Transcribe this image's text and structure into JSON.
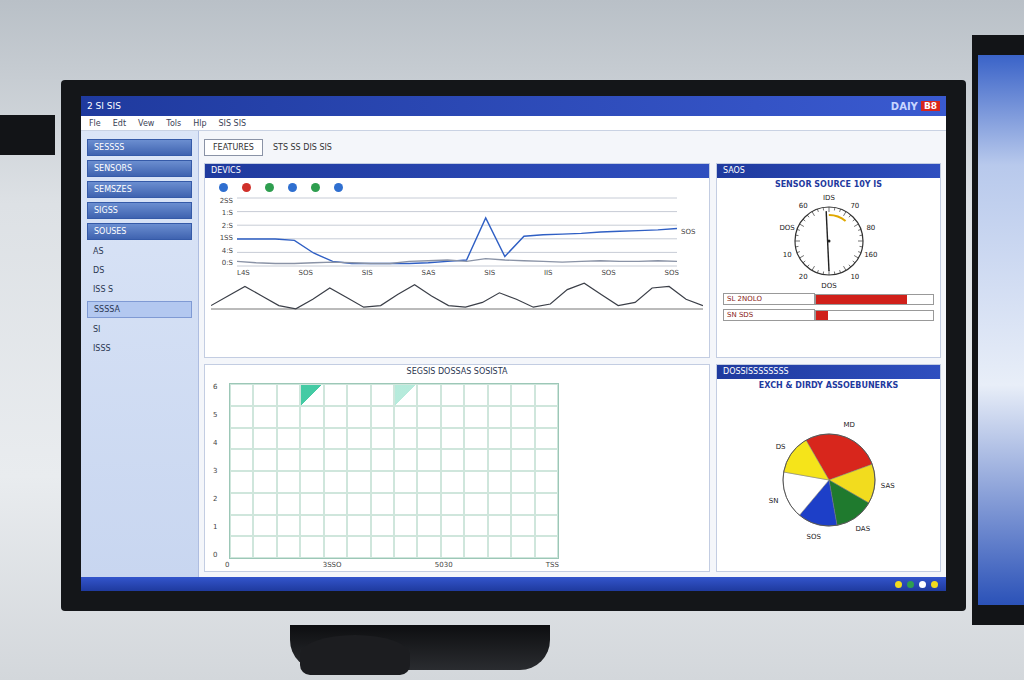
{
  "window": {
    "title": "2 SI SIS",
    "badge": "DAIY",
    "badge_code": "B8"
  },
  "menu": [
    "Fle",
    "Edt",
    "Vew",
    "Tols",
    "Hlp",
    "SIS SIS"
  ],
  "sidebar": {
    "items": [
      {
        "label": "SESSSS",
        "kind": "header",
        "selected": false
      },
      {
        "label": "SENSORS",
        "kind": "header",
        "selected": false
      },
      {
        "label": "SEMSZES",
        "kind": "header",
        "selected": false
      },
      {
        "label": "SIGSS",
        "kind": "header",
        "selected": false
      },
      {
        "label": "SOUSES",
        "kind": "header",
        "selected": false
      },
      {
        "label": "AS",
        "kind": "item",
        "selected": false
      },
      {
        "label": "DS",
        "kind": "item",
        "selected": false
      },
      {
        "label": "ISS S",
        "kind": "item",
        "selected": false
      },
      {
        "label": "SSSSA",
        "kind": "item",
        "selected": true
      },
      {
        "label": "SI",
        "kind": "item",
        "selected": false
      },
      {
        "label": "ISSS",
        "kind": "item",
        "selected": false
      }
    ]
  },
  "toolbar": {
    "button": "FEATURES",
    "text": "STS SS DIS SIS"
  },
  "device_panel": {
    "title": "DEVICS",
    "markers": [
      {
        "color": "#2f6fd0"
      },
      {
        "color": "#d0302a"
      },
      {
        "color": "#2e9e4f"
      },
      {
        "color": "#2f6fd0"
      },
      {
        "color": "#2e9e4f"
      },
      {
        "color": "#2f6fd0"
      }
    ],
    "side_label": "SOS",
    "chart": {
      "y_ticks": [
        "2SS",
        "1:S",
        "2:S",
        "1SS",
        "4:S",
        "0:S"
      ],
      "x_ticks": [
        "L4S",
        "SOS",
        "SIS",
        "SAS",
        "SIS",
        "IIS",
        "SOS",
        "SOS"
      ],
      "series": [
        {
          "name": "flow",
          "color": "#2f5fc4",
          "values": [
            40,
            40,
            40,
            38,
            20,
            8,
            5,
            5,
            5,
            5,
            6,
            8,
            10,
            70,
            15,
            44,
            46,
            47,
            48,
            50,
            51,
            52,
            53,
            55
          ]
        },
        {
          "name": "base",
          "color": "#8a93a6",
          "values": [
            8,
            6,
            5,
            5,
            6,
            7,
            6,
            5,
            5,
            8,
            9,
            10,
            8,
            12,
            10,
            9,
            8,
            7,
            8,
            9,
            8,
            8,
            9,
            8
          ]
        }
      ]
    },
    "wave": {
      "values": [
        20,
        50,
        80,
        50,
        20,
        10,
        40,
        75,
        45,
        15,
        20,
        55,
        85,
        50,
        20,
        15,
        30,
        60,
        40,
        15,
        25,
        70,
        90,
        55,
        20,
        30,
        75,
        80,
        40,
        20
      ]
    }
  },
  "gauge_panel": {
    "title": "SAOS",
    "subtitle": "SENSOR SOURCE 10Y IS",
    "gauge": {
      "level": 0.48,
      "ticks": [
        "IDS",
        "70",
        "80",
        "160",
        "10",
        "DOS",
        "20",
        "10",
        "DOS",
        "60"
      ]
    },
    "bars": [
      {
        "label": "SL 2NOLO",
        "level": 0.78
      },
      {
        "label": "SN SDS",
        "level": 0.1
      }
    ]
  },
  "grid_panel": {
    "title": "SEGSIS DOSSAS SOSISTA",
    "y_ticks": [
      "6",
      "5",
      "4",
      "3",
      "2",
      "1",
      "0"
    ],
    "x_ticks": [
      "0",
      "3SSO",
      "5030",
      "TSS"
    ],
    "cells": [
      0,
      0,
      0,
      0.9,
      0,
      0,
      0,
      0.35,
      0,
      0,
      0,
      0,
      0,
      0
    ]
  },
  "pie_panel": {
    "title": "DOSSISSSSSSSS",
    "subtitle": "EXCH & DIRDY ASSOEBUNERKS",
    "slices": [
      {
        "label": "MD",
        "value": 100,
        "color": "#d8261c"
      },
      {
        "label": "SAS",
        "value": 50,
        "color": "#f2dc1e"
      },
      {
        "label": "DAS",
        "value": 50,
        "color": "#1f7a2e"
      },
      {
        "label": "SOS",
        "value": 50,
        "color": "#1d3fc8"
      },
      {
        "label": "SN",
        "value": 60,
        "color": "#ffffff"
      },
      {
        "label": "DS",
        "value": 50,
        "color": "#f5e41a"
      }
    ]
  }
}
